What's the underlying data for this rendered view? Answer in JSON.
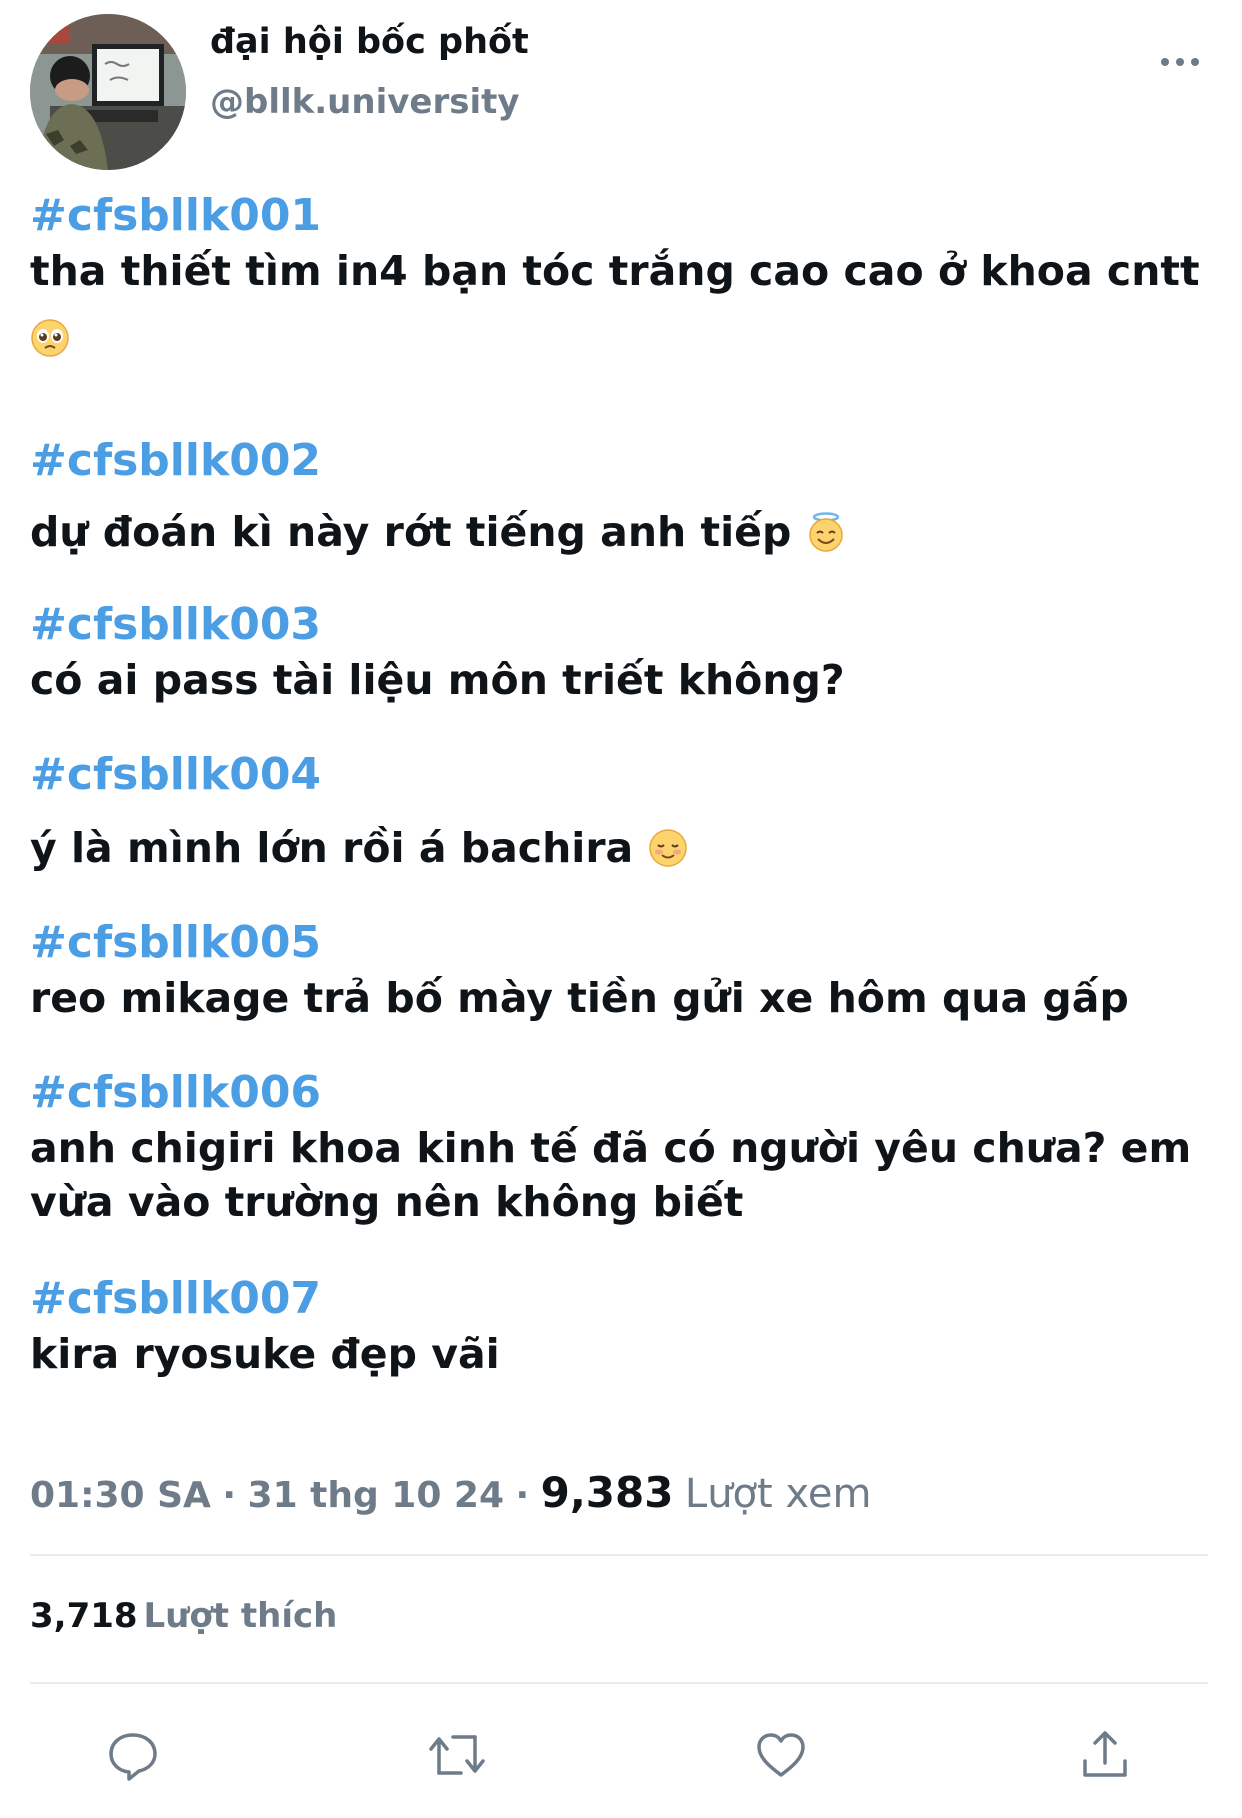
{
  "author": {
    "display_name": "đại hội bốc phốt",
    "handle": "@bllk.university"
  },
  "posts": [
    {
      "hashtag": "#cfsbllk001",
      "text": "tha thiết tìm in4 bạn tóc trắng cao cao ở khoa cntt",
      "emoji": "pleading-face-emoji"
    },
    {
      "hashtag": "#cfsbllk002",
      "text": "dự đoán kì này rớt tiếng anh tiếp",
      "emoji": "halo-face-emoji"
    },
    {
      "hashtag": "#cfsbllk003",
      "text": "có ai pass tài liệu môn triết không?"
    },
    {
      "hashtag": "#cfsbllk004",
      "text": "ý là mình lớn rồi á bachira",
      "emoji": "smiling-blush-emoji"
    },
    {
      "hashtag": "#cfsbllk005",
      "text": "reo mikage trả bố mày tiền gửi xe hôm qua gấp"
    },
    {
      "hashtag": "#cfsbllk006",
      "text": "anh chigiri khoa kinh tế đã có người yêu chưa? em vừa vào trường nên không biết"
    },
    {
      "hashtag": "#cfsbllk007",
      "text": "kira ryosuke đẹp vãi"
    }
  ],
  "meta": {
    "time": "01:30 SA",
    "separator": "·",
    "date": "31 thg 10 24",
    "views_count": "9,383",
    "views_label": "Lượt xem"
  },
  "likes": {
    "count": "3,718",
    "label": "Lượt thích"
  },
  "actions": [
    "reply-icon",
    "retweet-icon",
    "like-icon",
    "share-icon"
  ],
  "colors": {
    "hashtag": "#4b9de4",
    "text": "#0f1419",
    "secondary": "#6e7b88",
    "divider": "#e6ecf0"
  }
}
